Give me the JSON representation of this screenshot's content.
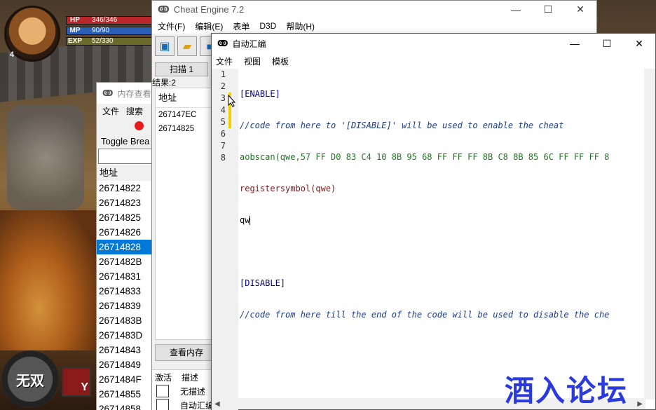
{
  "game": {
    "level": "4",
    "hp_label": "HP",
    "hp_value": "346/346",
    "mp_label": "MP",
    "mp_value": "90/90",
    "exp_label": "EXP",
    "exp_value": "52/330",
    "skill_label": "无双",
    "skill_key": "Y"
  },
  "memview": {
    "title": "内存查看",
    "menu": [
      "文件",
      "搜索"
    ],
    "toggle_label": "Toggle Brea",
    "col_header": "地址",
    "addresses": [
      "26714822",
      "26714823",
      "26714825",
      "26714826",
      "26714828",
      "2671482B",
      "26714831",
      "26714833",
      "26714839",
      "2671483B",
      "2671483D",
      "26714843",
      "26714849",
      "2671484F",
      "26714855",
      "26714858"
    ],
    "selected_index": 4
  },
  "ce": {
    "title": "Cheat Engine 7.2",
    "menu": [
      "文件(F)",
      "编辑(E)",
      "表单",
      "D3D",
      "帮助(H)"
    ],
    "scan_button": "扫描 1",
    "results_label": "结果:2",
    "results_header": "地址",
    "results": [
      "267147EC",
      "26714825"
    ],
    "view_memory_button": "查看内存",
    "table_headers": [
      "激活",
      "描述"
    ],
    "table_rows": [
      "无描述",
      "自动汇编"
    ]
  },
  "aa": {
    "title": "自动汇编",
    "menu": [
      "文件",
      "视图",
      "模板"
    ],
    "line_numbers": [
      "1",
      "2",
      "3",
      "4",
      "5",
      "6",
      "7",
      "8"
    ],
    "lines": [
      "[ENABLE]",
      "//code from here to '[DISABLE]' will be used to enable the cheat",
      "aobscan(qwe,57 FF D0 83 C4 10 8B 95 68 FF FF FF 8B C8 8B 85 6C FF FF FF 8",
      "registersymbol(qwe)",
      "qw",
      "",
      "[DISABLE]",
      "//code from here till the end of the code will be used to disable the che"
    ]
  },
  "watermark": "酒入论坛"
}
